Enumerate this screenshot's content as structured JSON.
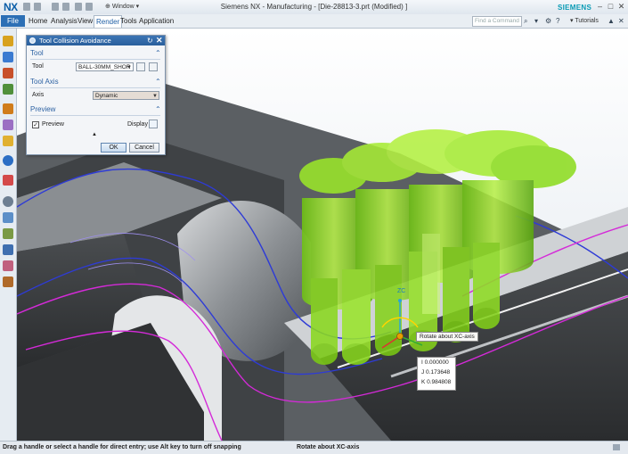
{
  "titlebar": {
    "logo": "NX",
    "window_menu": "Window",
    "app_title": "Siemens NX - Manufacturing - [Die-28813-3.prt (Modified) ]",
    "brand": "SIEMENS",
    "minimize": "–",
    "maximize": "□",
    "close": "✕"
  },
  "ribbon": {
    "file": "File",
    "tabs": [
      "Home",
      "Analysis",
      "View",
      "Render",
      "Tools",
      "Application"
    ],
    "active_tab": "Render",
    "find_placeholder": "Find a Command",
    "tutorials": "Tutorials"
  },
  "dialog": {
    "title": "Tool Collision Avoidance",
    "reset_icon": "↻",
    "close_icon": "✕",
    "group_tool": "Tool",
    "tool_label": "Tool",
    "tool_value": "BALL-30MM_SHOR",
    "group_axis": "Tool Axis",
    "axis_label": "Axis",
    "axis_value": "Dynamic",
    "group_preview": "Preview",
    "preview_label": "Preview",
    "preview_checked": "✓",
    "display_label": "Display",
    "ok": "OK",
    "cancel": "Cancel"
  },
  "viewport": {
    "axis_label": "ZC",
    "tooltip": "Rotate about XC-axis",
    "vector": [
      "I 0.000000",
      "J 0.173648",
      "K 0.984808"
    ]
  },
  "status": {
    "left": "Drag a handle or select a handle for direct entry; use Alt key to turn off snapping",
    "middle": "Rotate about XC-axis"
  },
  "colors": {
    "tool_green": "#8fe21b",
    "path_blue": "#2e3bd6",
    "path_magenta": "#d42ad8",
    "ribbon_blue": "#2c6fb5"
  }
}
